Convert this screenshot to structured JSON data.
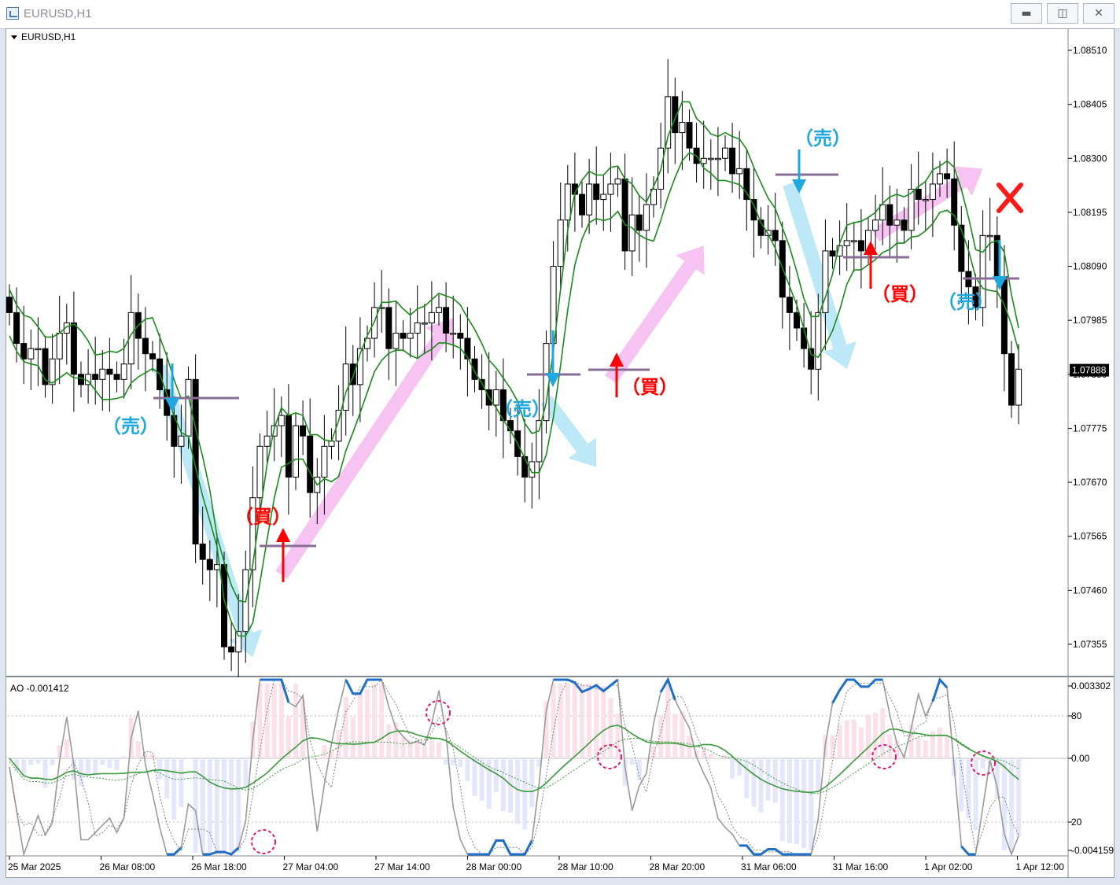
{
  "window": {
    "title": "EURUSD,H1",
    "minimize": "▬",
    "maximize": "◫",
    "close": "✕"
  },
  "chart_data": [
    {
      "type": "candlestick",
      "title": "EURUSD,H1",
      "ylim": [
        1.073,
        1.0856
      ],
      "y_ticks": [
        "1.08510",
        "1.08405",
        "1.08300",
        "1.08195",
        "1.08090",
        "1.07985",
        "1.07880",
        "1.07775",
        "1.07670",
        "1.07565",
        "1.07460",
        "1.07355"
      ],
      "current_price": "1.07888",
      "x_ticks": [
        "25 Mar 2025",
        "26 Mar 08:00",
        "26 Mar 18:00",
        "27 Mar 04:00",
        "27 Mar 14:00",
        "28 Mar 00:00",
        "28 Mar 10:00",
        "28 Mar 20:00",
        "31 Mar 06:00",
        "31 Mar 16:00",
        "1 Apr 02:00",
        "1 Apr 12:00"
      ],
      "closes": [
        1.08,
        1.0794,
        1.0791,
        1.0793,
        1.0793,
        1.0786,
        1.0791,
        1.0796,
        1.0798,
        1.0788,
        1.0786,
        1.0788,
        1.0787,
        1.0789,
        1.0788,
        1.0787,
        1.079,
        1.08,
        1.0795,
        1.0792,
        1.0791,
        1.0785,
        1.078,
        1.0774,
        1.0776,
        1.0787,
        1.0755,
        1.0752,
        1.075,
        1.0751,
        1.0735,
        1.0734,
        1.0738,
        1.075,
        1.0764,
        1.0774,
        1.0776,
        1.0778,
        1.078,
        1.0768,
        1.0778,
        1.0776,
        1.0765,
        1.0768,
        1.0774,
        1.0775,
        1.0781,
        1.079,
        1.0786,
        1.0793,
        1.0795,
        1.0801,
        1.0801,
        1.0793,
        1.0796,
        1.0795,
        1.0796,
        1.0798,
        1.0798,
        1.08,
        1.0801,
        1.0796,
        1.0796,
        1.0795,
        1.0791,
        1.0787,
        1.0785,
        1.0782,
        1.0785,
        1.0779,
        1.0777,
        1.0772,
        1.0768,
        1.0771,
        1.0779,
        1.0794,
        1.0809,
        1.0818,
        1.0825,
        1.0823,
        1.0819,
        1.0825,
        1.0822,
        1.0823,
        1.0825,
        1.0826,
        1.0812,
        1.0819,
        1.0816,
        1.0821,
        1.0824,
        1.0832,
        1.0842,
        1.0835,
        1.0837,
        1.0832,
        1.0829,
        1.083,
        1.083,
        1.083,
        1.0832,
        1.0827,
        1.0828,
        1.0822,
        1.0818,
        1.0815,
        1.0816,
        1.0814,
        1.0803,
        1.08,
        1.0797,
        1.0793,
        1.0789,
        1.08,
        1.0812,
        1.0811,
        1.0813,
        1.0814,
        1.0814,
        1.0812,
        1.0816,
        1.0818,
        1.0821,
        1.0817,
        1.0818,
        1.0816,
        1.0824,
        1.0822,
        1.0822,
        1.0825,
        1.0827,
        1.0826,
        1.0817,
        1.0808,
        1.0805,
        1.0801,
        1.0815,
        1.0815,
        1.0807,
        1.0792,
        1.0782,
        1.0789
      ]
    },
    {
      "type": "line",
      "title": "AO -0.001412",
      "y_ticks": [
        "0.003302",
        "80",
        "0.00",
        "20",
        "-0.004159"
      ]
    }
  ],
  "annotations": {
    "sell": "（売）",
    "buy": "（買）"
  },
  "colors": {
    "bear": "#000000",
    "bull": "#ffffff",
    "ma": "#1a8a1a",
    "buy": "#ff0000",
    "sell": "#1fa8e0",
    "pink": "#f5b8f0",
    "cyan": "#b0e4f7",
    "level": "#8a6d96",
    "ao_blue": "#1f6fc8",
    "ao_red": "#b01818",
    "ao_orange": "#f39c1a",
    "ao_magenta": "#c0187a",
    "circle": "#e01870"
  }
}
